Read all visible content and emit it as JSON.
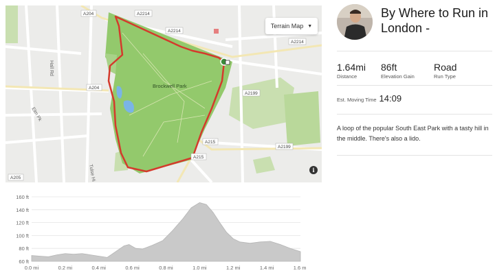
{
  "map": {
    "terrain_button": "Terrain Map",
    "park_label": "Brockwell Park",
    "road_labels": [
      "A204",
      "A2214",
      "A2214",
      "A2214",
      "A204",
      "A2199",
      "A215",
      "A215",
      "A2199",
      "A205"
    ],
    "street_labels": [
      "Hall Rd",
      "Elm Pk",
      "Tulse Hi"
    ]
  },
  "route": {
    "title": "By Where to Run in London -",
    "description": "A loop of the popular South East Park with a tasty hill in the middle. There's also a lido."
  },
  "stats": [
    {
      "value": "1.64mi",
      "label": "Distance"
    },
    {
      "value": "86ft",
      "label": "Elevation Gain"
    },
    {
      "value": "Road",
      "label": "Run Type"
    }
  ],
  "moving_time": {
    "label": "Est. Moving Time",
    "value": "14:09"
  },
  "elevation": {
    "y_ticks": [
      "160 ft",
      "140 ft",
      "120 ft",
      "100 ft",
      "80 ft",
      "60 ft"
    ],
    "x_ticks": [
      "0.0 mi",
      "0.2 mi",
      "0.4 mi",
      "0.6 mi",
      "0.8 mi",
      "1.0 mi",
      "1.2 mi",
      "1.4 mi",
      "1.6 mi"
    ],
    "profile_ft": [
      [
        0,
        69
      ],
      [
        0.05,
        68
      ],
      [
        0.1,
        67
      ],
      [
        0.15,
        70
      ],
      [
        0.2,
        72
      ],
      [
        0.25,
        71
      ],
      [
        0.3,
        72
      ],
      [
        0.35,
        70
      ],
      [
        0.4,
        68
      ],
      [
        0.45,
        66
      ],
      [
        0.5,
        75
      ],
      [
        0.55,
        84
      ],
      [
        0.58,
        86
      ],
      [
        0.62,
        80
      ],
      [
        0.66,
        79
      ],
      [
        0.72,
        85
      ],
      [
        0.78,
        92
      ],
      [
        0.84,
        108
      ],
      [
        0.9,
        126
      ],
      [
        0.95,
        143
      ],
      [
        1.0,
        151
      ],
      [
        1.04,
        148
      ],
      [
        1.08,
        136
      ],
      [
        1.12,
        120
      ],
      [
        1.16,
        105
      ],
      [
        1.2,
        95
      ],
      [
        1.24,
        90
      ],
      [
        1.3,
        88
      ],
      [
        1.36,
        90
      ],
      [
        1.42,
        91
      ],
      [
        1.48,
        86
      ],
      [
        1.54,
        80
      ],
      [
        1.6,
        75
      ],
      [
        1.64,
        73
      ]
    ]
  }
}
